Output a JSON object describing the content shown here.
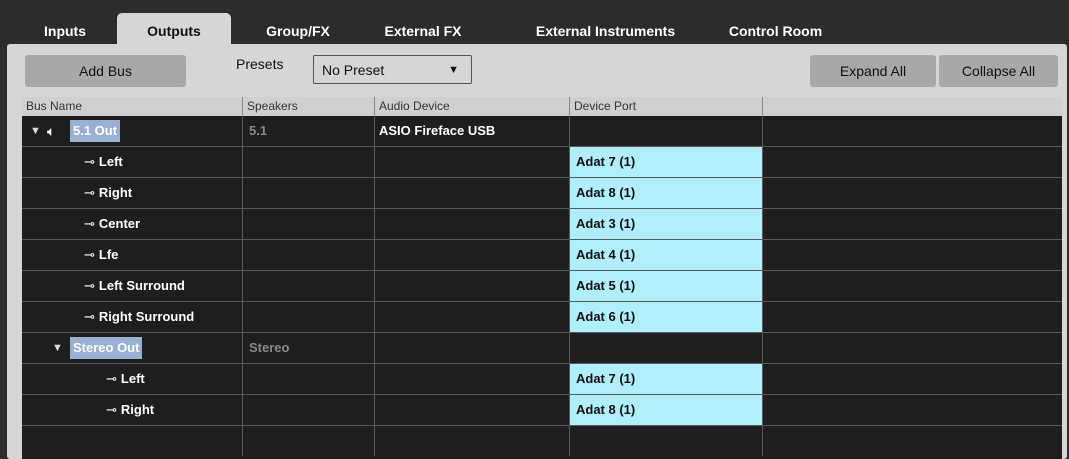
{
  "tabs": [
    {
      "label": "Inputs",
      "active": false
    },
    {
      "label": "Outputs",
      "active": true
    },
    {
      "label": "Group/FX",
      "active": false
    },
    {
      "label": "External FX",
      "active": false
    },
    {
      "label": "External Instruments",
      "active": false
    },
    {
      "label": "Control Room",
      "active": false
    }
  ],
  "toolbar": {
    "add_bus": "Add Bus",
    "presets_label": "Presets",
    "preset_value": "No Preset",
    "expand_all": "Expand All",
    "collapse_all": "Collapse All"
  },
  "columns": [
    "Bus Name",
    "Speakers",
    "Audio Device",
    "Device Port"
  ],
  "buses": [
    {
      "name": "5.1 Out",
      "speakers": "5.1",
      "device": "ASIO Fireface USB",
      "channels": [
        {
          "name": "Left",
          "port": "Adat 7 (1)"
        },
        {
          "name": "Right",
          "port": "Adat 8 (1)"
        },
        {
          "name": "Center",
          "port": "Adat 3 (1)"
        },
        {
          "name": "Lfe",
          "port": "Adat 4 (1)"
        },
        {
          "name": "Left Surround",
          "port": "Adat 5 (1)"
        },
        {
          "name": "Right Surround",
          "port": "Adat 6 (1)"
        }
      ]
    },
    {
      "name": "Stereo Out",
      "speakers": "Stereo",
      "device": "",
      "channels": [
        {
          "name": "Left",
          "port": "Adat 7 (1)"
        },
        {
          "name": "Right",
          "port": "Adat 8 (1)"
        }
      ]
    }
  ],
  "colors": {
    "port_highlight": "#b0eefb",
    "bus_highlight": "#9ab0d2",
    "panel": "#d6d6d6",
    "grid": "#1e1e1e"
  }
}
